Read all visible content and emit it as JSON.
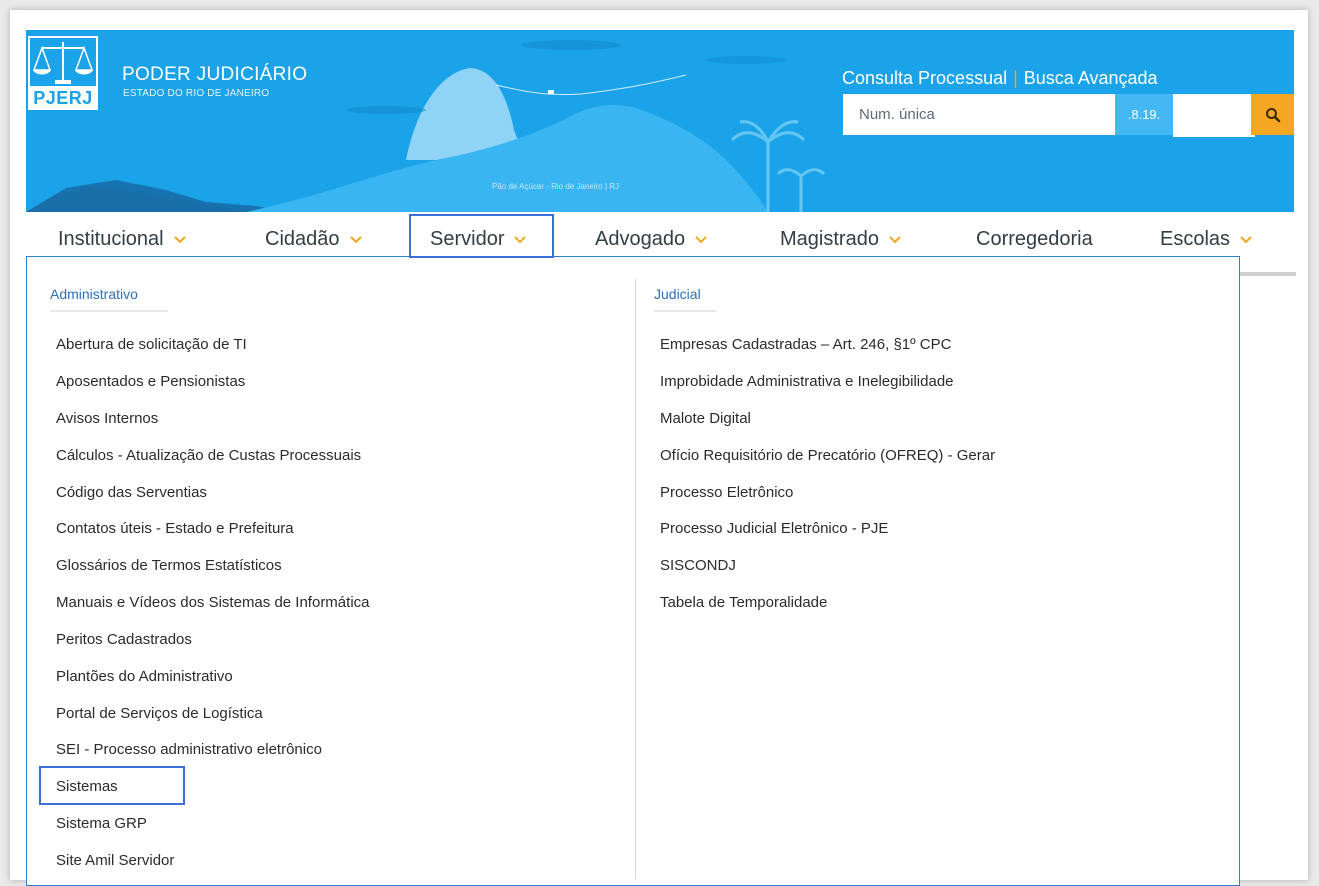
{
  "header": {
    "logo_text": "PJERJ",
    "org_name": "PODER JUDICIÁRIO",
    "org_subtitle": "ESTADO DO RIO DE JANEIRO",
    "photo_caption": "Pão de Açúcar - Rio de Janeiro | RJ",
    "links": {
      "consulta": "Consulta Processual",
      "separator": "|",
      "busca": "Busca Avançada"
    },
    "search": {
      "placeholder": "Num. única",
      "suffix": ".8.19.",
      "button_icon": "search-icon"
    },
    "colors": {
      "banner": "#1aa3e8",
      "accent": "#f5a623",
      "highlight": "#3a6fd8"
    }
  },
  "nav": {
    "items": [
      {
        "label": "Institucional",
        "has_chevron": true
      },
      {
        "label": "Cidadão",
        "has_chevron": true
      },
      {
        "label": "Servidor",
        "has_chevron": true,
        "active": true
      },
      {
        "label": "Advogado",
        "has_chevron": true
      },
      {
        "label": "Magistrado",
        "has_chevron": true
      },
      {
        "label": "Corregedoria",
        "has_chevron": false
      },
      {
        "label": "Escolas",
        "has_chevron": true
      }
    ]
  },
  "dropdown": {
    "administrativo": {
      "title": "Administrativo",
      "items": [
        "Abertura de solicitação de TI",
        "Aposentados e Pensionistas",
        "Avisos Internos",
        "Cálculos - Atualização de Custas Processuais",
        "Código das Serventias",
        "Contatos úteis - Estado e Prefeitura",
        "Glossários de Termos Estatísticos",
        "Manuais e Vídeos dos Sistemas de Informática",
        "Peritos Cadastrados",
        "Plantões do Administrativo",
        "Portal de Serviços de Logística",
        "SEI - Processo administrativo eletrônico",
        "Sistemas",
        "Sistema GRP",
        "Site Amil Servidor"
      ]
    },
    "judicial": {
      "title": "Judicial",
      "items": [
        "Empresas Cadastradas – Art. 246, §1º CPC",
        "Improbidade Administrativa e Inelegibilidade",
        "Malote Digital",
        "Ofício Requisitório de Precatório (OFREQ) - Gerar",
        "Processo Eletrônico",
        "Processo Judicial Eletrônico - PJE",
        "SISCONDJ",
        "Tabela de Temporalidade"
      ]
    }
  }
}
